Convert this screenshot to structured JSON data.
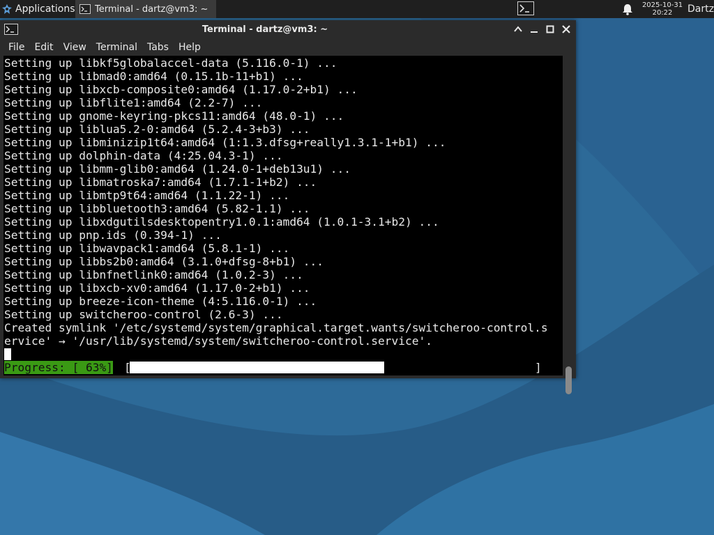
{
  "panel": {
    "apps_label": "Applications",
    "task_label": "Terminal - dartz@vm3: ~",
    "clock_date": "2025-10-31",
    "clock_time": "20:22",
    "user": "Dartz"
  },
  "window": {
    "title": "Terminal - dartz@vm3: ~",
    "menu": [
      "File",
      "Edit",
      "View",
      "Terminal",
      "Tabs",
      "Help"
    ]
  },
  "terminal": {
    "lines": [
      "Setting up libkf5globalaccel-data (5.116.0-1) ...",
      "Setting up libmad0:amd64 (0.15.1b-11+b1) ...",
      "Setting up libxcb-composite0:amd64 (1.17.0-2+b1) ...",
      "Setting up libflite1:amd64 (2.2-7) ...",
      "Setting up gnome-keyring-pkcs11:amd64 (48.0-1) ...",
      "Setting up liblua5.2-0:amd64 (5.2.4-3+b3) ...",
      "Setting up libminizip1t64:amd64 (1:1.3.dfsg+really1.3.1-1+b1) ...",
      "Setting up dolphin-data (4:25.04.3-1) ...",
      "Setting up libmm-glib0:amd64 (1.24.0-1+deb13u1) ...",
      "Setting up libmatroska7:amd64 (1.7.1-1+b2) ...",
      "Setting up libmtp9t64:amd64 (1.1.22-1) ...",
      "Setting up libbluetooth3:amd64 (5.82-1.1) ...",
      "Setting up libxdgutilsdesktopentry1.0.1:amd64 (1.0.1-3.1+b2) ...",
      "Setting up pnp.ids (0.394-1) ...",
      "Setting up libwavpack1:amd64 (5.8.1-1) ...",
      "Setting up libbs2b0:amd64 (3.1.0+dfsg-8+b1) ...",
      "Setting up libnfnetlink0:amd64 (1.0.2-3) ...",
      "Setting up libxcb-xv0:amd64 (1.17.0-2+b1) ...",
      "Setting up breeze-icon-theme (4:5.116.0-1) ...",
      "Setting up switcheroo-control (2.6-3) ...",
      "Created symlink '/etc/systemd/system/graphical.target.wants/switcheroo-control.s",
      "ervice' → '/usr/lib/systemd/system/switcheroo-control.service'."
    ],
    "progress_label": "Progress: [ 63%]",
    "progress_open": "[",
    "progress_close": "]",
    "progress_fraction": 0.63
  },
  "icons": {
    "apps": "apps-menu-icon",
    "task": "terminal-icon",
    "tray": "terminal-icon",
    "bell": "bell-icon"
  }
}
